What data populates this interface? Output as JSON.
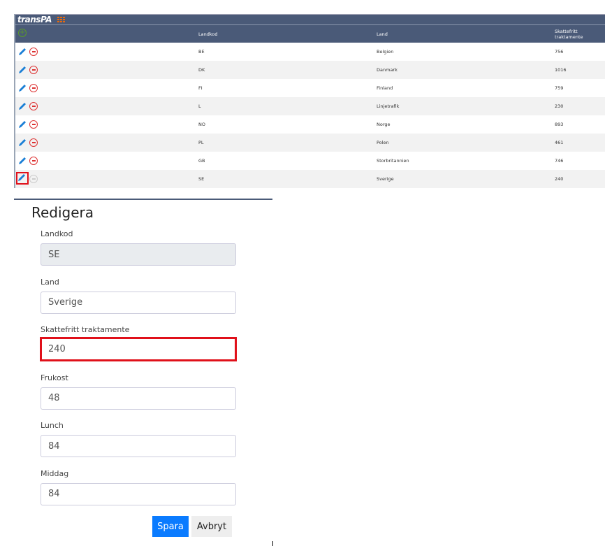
{
  "app": {
    "logo": "transPA"
  },
  "table": {
    "headers": [
      "Landkod",
      "Land",
      "Skattefritt traktamente"
    ],
    "rows": [
      [
        "BE",
        "Belgien",
        "756"
      ],
      [
        "DK",
        "Danmark",
        "1016"
      ],
      [
        "FI",
        "Finland",
        "759"
      ],
      [
        "L",
        "Linjetrafik",
        "230"
      ],
      [
        "NO",
        "Norge",
        "893"
      ],
      [
        "PL",
        "Polen",
        "461"
      ],
      [
        "GB",
        "Storbritannien",
        "746"
      ],
      [
        "SE",
        "Sverige",
        "240"
      ]
    ]
  },
  "form": {
    "title": "Redigera",
    "fields": [
      {
        "label": "Landkod",
        "value": "SE"
      },
      {
        "label": "Land",
        "value": "Sverige"
      },
      {
        "label": "Skattefritt traktamente",
        "value": "240"
      },
      {
        "label": "Frukost",
        "value": "48"
      },
      {
        "label": "Lunch",
        "value": "84"
      },
      {
        "label": "Middag",
        "value": "84"
      }
    ],
    "save": "Spara",
    "cancel": "Avbryt"
  },
  "colors": {
    "header": "#4a5a78",
    "accent": "#0a7bff",
    "highlight": "#e0101a"
  }
}
